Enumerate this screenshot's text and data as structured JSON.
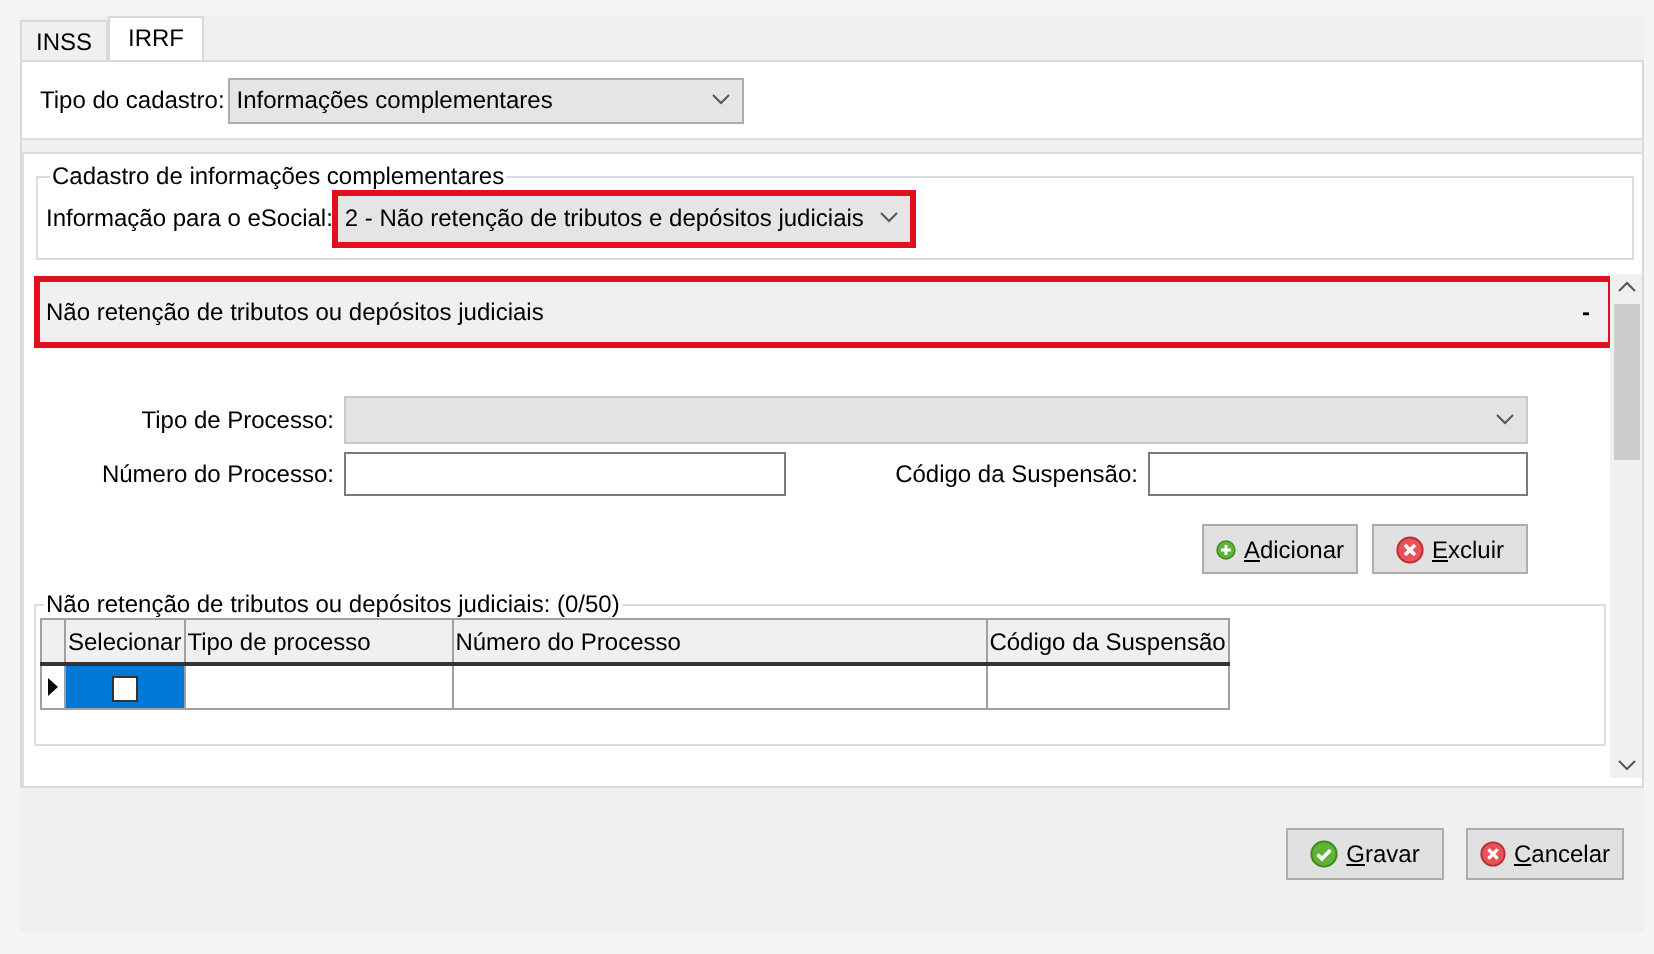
{
  "tabs": [
    {
      "label": "INSS",
      "selected": false
    },
    {
      "label": "IRRF",
      "selected": true
    }
  ],
  "registration_type": {
    "label": "Tipo do cadastro:",
    "value": "Informações complementares"
  },
  "complementary_group": {
    "title": "Cadastro de informações complementares",
    "esocial_info": {
      "label": "Informação para o eSocial:",
      "value": "2 - Não retenção de tributos e depósitos judiciais",
      "highlighted": true
    }
  },
  "section": {
    "title": "Não retenção de tributos ou depósitos judiciais",
    "toggle": "-",
    "highlighted": true,
    "fields": [
      {
        "kind": "combo",
        "label": "Tipo de Processo:",
        "disabled": true
      },
      {
        "kind": "text",
        "label": "Número do Processo:"
      },
      {
        "kind": "text",
        "label": "Código da Suspensão:"
      }
    ],
    "buttons": [
      {
        "label": "Adicionar",
        "kind": "add",
        "underline_first": true
      },
      {
        "label": "Excluir",
        "kind": "remove",
        "underline_first": true
      }
    ],
    "table": {
      "title": "Não retenção de tributos ou depósitos judiciais: (0/50)",
      "columns": [
        "Selecionar",
        "Tipo de processo",
        "Número do Processo",
        "Código da Suspensão"
      ],
      "rows": [
        {
          "selected": true,
          "checked": false
        }
      ]
    }
  },
  "footer_buttons": [
    {
      "label": "Gravar",
      "kind": "confirm",
      "underline_first": true
    },
    {
      "label": "Cancelar",
      "kind": "cancel",
      "underline_first": true
    }
  ]
}
